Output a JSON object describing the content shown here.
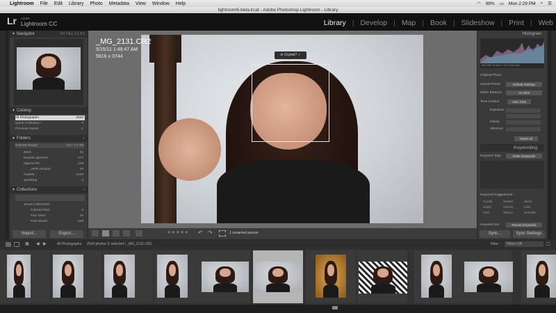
{
  "menubar": {
    "app_name": "Lightroom",
    "items": [
      "File",
      "Edit",
      "Library",
      "Photo",
      "Metadata",
      "View",
      "Window",
      "Help"
    ],
    "battery": "99%",
    "clock": "Mon 2:29 PM"
  },
  "window": {
    "title": "lightroom6-beta.lrcat - Adobe Photoshop Lightroom - Library"
  },
  "identity": {
    "logo": "Lr",
    "adobe": "Adobe",
    "product": "Lightroom CC"
  },
  "modules": [
    "Library",
    "Develop",
    "Map",
    "Book",
    "Slideshow",
    "Print",
    "Web"
  ],
  "navigator": {
    "title": "Navigator",
    "zoom_options": "FIT   FILL   1:1   3:1"
  },
  "catalog": {
    "title": "Catalog",
    "rows": [
      {
        "label": "All Photographs",
        "count": "2543"
      },
      {
        "label": "Quick Collection +",
        "count": "0"
      },
      {
        "label": "Previous Import",
        "count": "1"
      }
    ]
  },
  "folders": {
    "title": "Folders",
    "volume": {
      "label": "G-RAID Studio",
      "info": "4.9 / 7.3 TB"
    },
    "rows": [
      {
        "label": "2018",
        "count": "31"
      },
      {
        "label": "bracket aperture",
        "count": "177"
      },
      {
        "label": "laguna-fob",
        "count": "249"
      },
      {
        "label": "_HDR merged",
        "count": "18"
      },
      {
        "label": "models",
        "count": "2100"
      },
      {
        "label": "speaking",
        "count": "2"
      }
    ]
  },
  "collections": {
    "title": "Collections",
    "rows": [
      {
        "label": "Smart Collections",
        "count": ""
      },
      {
        "label": "Colored Red",
        "count": "0"
      },
      {
        "label": "Five Stars",
        "count": "10"
      },
      {
        "label": "Past Month",
        "count": "249"
      }
    ]
  },
  "left_buttons": {
    "import": "Import...",
    "export": "Export..."
  },
  "image_meta": {
    "filename": "_MG_2131.CR2",
    "datetime": "5/15/11 1:48:47 AM",
    "dimensions": "5616 x 3744"
  },
  "face_tag": {
    "label": "Crystal?",
    "accept": "✓",
    "reject": "⊘"
  },
  "right_panel": {
    "histogram_title": "Histogram",
    "histo_info": "ISO 400     70 mm     f / 2.8     1/125 sec",
    "original_photo": "Original Photo",
    "saved_preset": {
      "label": "Saved Preset",
      "value": "Default Settings"
    },
    "white_balance": {
      "label": "White Balance",
      "value": "As Shot"
    },
    "tone_control": {
      "label": "Tone Control",
      "value": "Auto Tone"
    },
    "exposure": "Exposure",
    "clarity": "Clarity",
    "vibrance": "Vibrance",
    "reset_all": "Reset All",
    "keywording_title": "Keywording",
    "keyword_tags": {
      "label": "Keyword Tags",
      "value": "Enter Keywords"
    },
    "keyword_suggestions_title": "Keyword Suggestions",
    "suggestions": [
      "Crystal",
      "woman",
      "studio",
      "model",
      "indoors",
      "Colin",
      "Cars",
      "Mexico",
      "mermaid"
    ],
    "keyword_set": {
      "label": "Keyword Set",
      "value": "Recent Keywords"
    },
    "sync": "Sync...",
    "sync_settings": "Sync Settings"
  },
  "toolbar": {
    "unnamed_person": "1 unnamed person"
  },
  "filmbar": {
    "source": "All Photographs",
    "info": "2543 photos /1 selected / _MG_2131.CR2",
    "filter_label": "Filter :",
    "filter_value": "Filters Off"
  },
  "filmstrip": {
    "selected_index": 5,
    "count": 11
  }
}
